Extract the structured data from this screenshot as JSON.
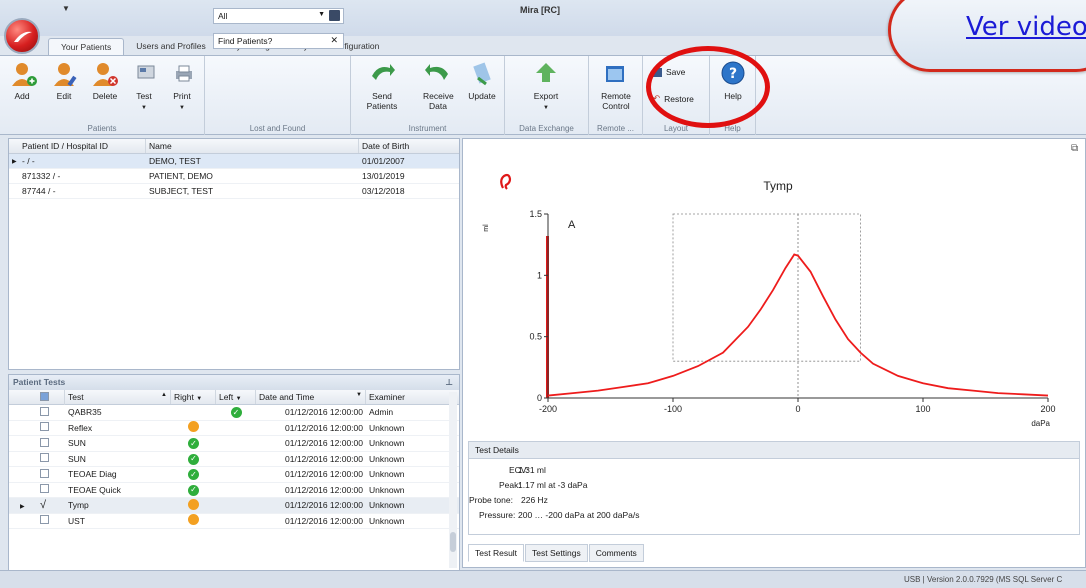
{
  "window": {
    "title": "Mira [RC]"
  },
  "tabs": [
    "Your Patients",
    "Users and Profiles",
    "My Settings",
    "System Configuration"
  ],
  "ribbon": {
    "patients_group": {
      "label": "Patients",
      "buttons": [
        "Add",
        "Edit",
        "Delete",
        "Test",
        "Print"
      ]
    },
    "lost_found": {
      "label": "Lost and Found",
      "combo_value": "All",
      "find_placeholder": "Find Patients?"
    },
    "instrument": {
      "label": "Instrument",
      "buttons": [
        "Send Patients",
        "Receive Data",
        "Update"
      ]
    },
    "data_exchange": {
      "label": "Data Exchange",
      "button": "Export"
    },
    "remote": {
      "label": "Remote ...",
      "button": "Remote Control"
    },
    "layout": {
      "label": "Layout",
      "save": "Save",
      "restore": "Restore"
    },
    "help": {
      "label": "Help",
      "button": "Help"
    }
  },
  "patients": {
    "headers": [
      "Patient ID / Hospital ID",
      "Name",
      "Date of Birth"
    ],
    "rows": [
      {
        "id": "- / -",
        "name": "DEMO, TEST",
        "dob": "01/01/2007"
      },
      {
        "id": "871332 / -",
        "name": "PATIENT, DEMO",
        "dob": "13/01/2019"
      },
      {
        "id": "87744 / -",
        "name": "SUBJECT, TEST",
        "dob": "03/12/2018"
      }
    ]
  },
  "patient_tests": {
    "title": "Patient Tests",
    "headers": [
      "Test",
      "Right",
      "Left",
      "Date and Time",
      "Examiner"
    ],
    "rows": [
      {
        "test": "QABR35",
        "right": "",
        "left": "green",
        "datetime": "01/12/2016 12:00:00",
        "examiner": "Admin"
      },
      {
        "test": "Reflex",
        "right": "orange",
        "left": "",
        "datetime": "01/12/2016 12:00:00",
        "examiner": "Unknown"
      },
      {
        "test": "SUN",
        "right": "green",
        "left": "",
        "datetime": "01/12/2016 12:00:00",
        "examiner": "Unknown"
      },
      {
        "test": "SUN",
        "right": "green",
        "left": "",
        "datetime": "01/12/2016 12:00:00",
        "examiner": "Unknown"
      },
      {
        "test": "TEOAE Diag",
        "right": "green",
        "left": "",
        "datetime": "01/12/2016 12:00:00",
        "examiner": "Unknown"
      },
      {
        "test": "TEOAE Quick",
        "right": "green",
        "left": "",
        "datetime": "01/12/2016 12:00:00",
        "examiner": "Unknown"
      },
      {
        "test": "Tymp",
        "right": "orange",
        "left": "",
        "datetime": "01/12/2016 12:00:00",
        "examiner": "Unknown"
      },
      {
        "test": "UST",
        "right": "orange",
        "left": "",
        "datetime": "01/12/2016 12:00:00",
        "examiner": "Unknown"
      }
    ]
  },
  "chart_data": {
    "type": "line",
    "title": "Tymp",
    "label": "A",
    "ylabel": "ml",
    "xlabel": "daPa",
    "xlim": [
      -200,
      200
    ],
    "ylim": [
      0,
      1.5
    ],
    "xticks": [
      "-200",
      "-100",
      "0",
      "100",
      "200"
    ],
    "yticks": [
      "0",
      "0.5",
      "1",
      "1.5"
    ],
    "series": [
      {
        "color": "#ee1c1c",
        "x": [
          -200,
          -180,
          -160,
          -140,
          -120,
          -100,
          -80,
          -60,
          -40,
          -30,
          -20,
          -10,
          -3,
          0,
          10,
          20,
          30,
          40,
          50,
          60,
          80,
          100,
          120,
          140,
          160,
          180,
          200
        ],
        "y": [
          0.02,
          0.04,
          0.06,
          0.09,
          0.12,
          0.18,
          0.26,
          0.37,
          0.58,
          0.72,
          0.88,
          1.06,
          1.17,
          1.16,
          1.03,
          0.83,
          0.64,
          0.48,
          0.37,
          0.28,
          0.18,
          0.12,
          0.08,
          0.06,
          0.04,
          0.03,
          0.02
        ]
      }
    ],
    "box": {
      "x": [
        -100,
        50
      ],
      "y": [
        0.3,
        1.5
      ]
    }
  },
  "details": {
    "title": "Test Details",
    "rows": [
      {
        "label": "ECV:",
        "value": "1.31 ml"
      },
      {
        "label": "Peak:",
        "value": "1.17 ml at -3 daPa"
      },
      {
        "label": "Probe tone:",
        "value": "226 Hz"
      },
      {
        "label": "Pressure:",
        "value": "200 … -200 daPa at 200 daPa/s"
      }
    ]
  },
  "bottom_tabs": [
    "Test Result",
    "Test Settings",
    "Comments"
  ],
  "status": {
    "right": "USB | Version 2.0.0.7929 (MS SQL Server C"
  },
  "overlay": {
    "video_link": "Ver video"
  }
}
